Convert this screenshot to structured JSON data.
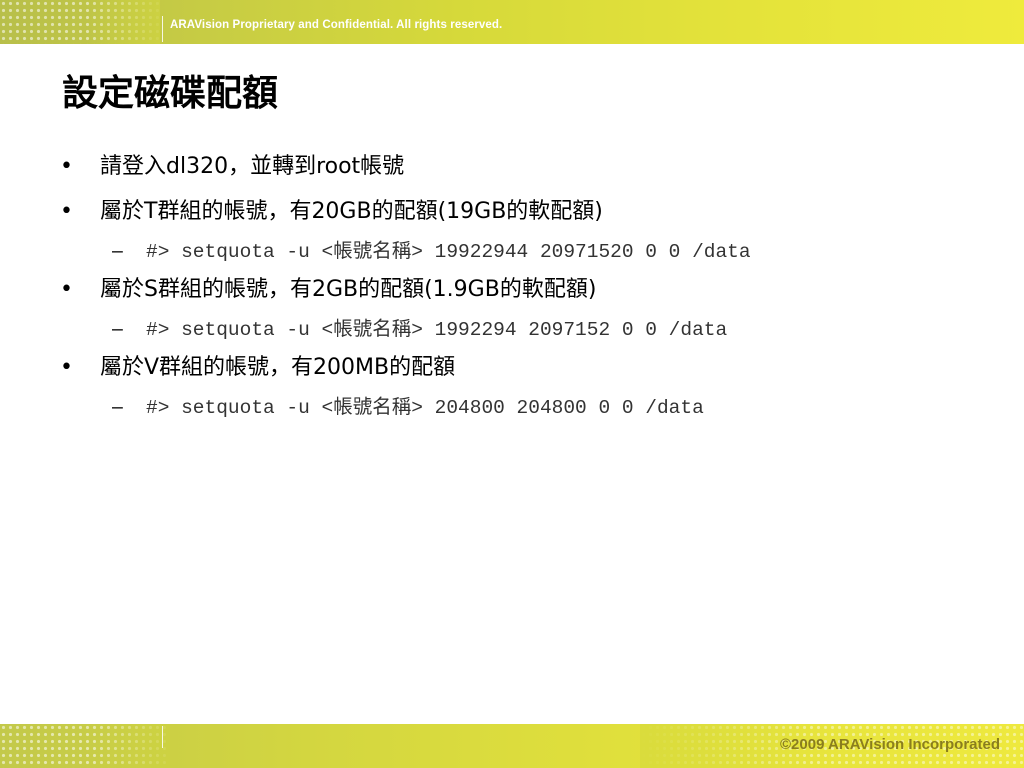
{
  "header": {
    "banner_text": "ARAVision Proprietary and Confidential. All rights reserved."
  },
  "title": "設定磁碟配額",
  "bullet_marker": "•",
  "sub_marker": "–",
  "bullets": [
    {
      "text": "請登入dl320，並轉到root帳號",
      "subs": []
    },
    {
      "text": "屬於T群組的帳號，有20GB的配額(19GB的軟配額)",
      "subs": [
        "#> setquota -u <帳號名稱> 19922944 20971520 0 0 /data"
      ]
    },
    {
      "text": "屬於S群組的帳號，有2GB的配額(1.9GB的軟配額)",
      "subs": [
        "#> setquota -u <帳號名稱> 1992294 2097152 0 0 /data"
      ]
    },
    {
      "text": "屬於V群組的帳號，有200MB的配額",
      "subs": [
        "#> setquota -u <帳號名稱> 204800 204800 0 0 /data"
      ]
    }
  ],
  "footer": {
    "copyright": "©2009 ARAVision Incorporated"
  },
  "colors": {
    "banner_start": "#b8bf4a",
    "banner_end": "#efeb3c",
    "copyright_text": "#8a7e1e"
  }
}
